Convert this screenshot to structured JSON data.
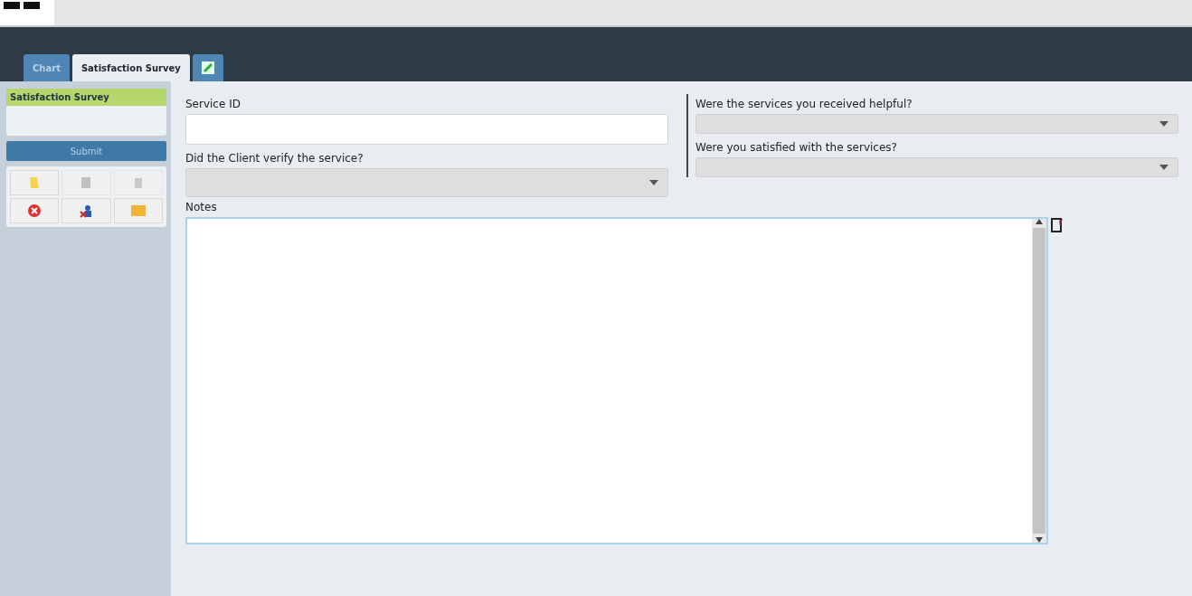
{
  "tabs": [
    {
      "label": "Chart",
      "selected": false
    },
    {
      "label": "Satisfaction Survey",
      "selected": true
    }
  ],
  "sidebar": {
    "items": [
      {
        "label": "Satisfaction Survey",
        "selected": true
      }
    ],
    "submit": "Submit",
    "tools": [
      {
        "kind": "note",
        "disabled": false
      },
      {
        "kind": "print",
        "disabled": true
      },
      {
        "kind": "trash",
        "disabled": true
      },
      {
        "kind": "cancel",
        "disabled": false
      },
      {
        "kind": "people",
        "disabled": false
      },
      {
        "kind": "mail",
        "disabled": false
      }
    ]
  },
  "form": {
    "left": [
      {
        "label": "Service ID",
        "kind": "text"
      },
      {
        "label": "Did the Client verify the service?",
        "kind": "select"
      }
    ],
    "right": [
      {
        "label": "Were the services you received helpful?",
        "kind": "select"
      },
      {
        "label": "Were you satisfied with the services?",
        "kind": "select"
      }
    ],
    "notes": {
      "label": "Notes"
    }
  }
}
